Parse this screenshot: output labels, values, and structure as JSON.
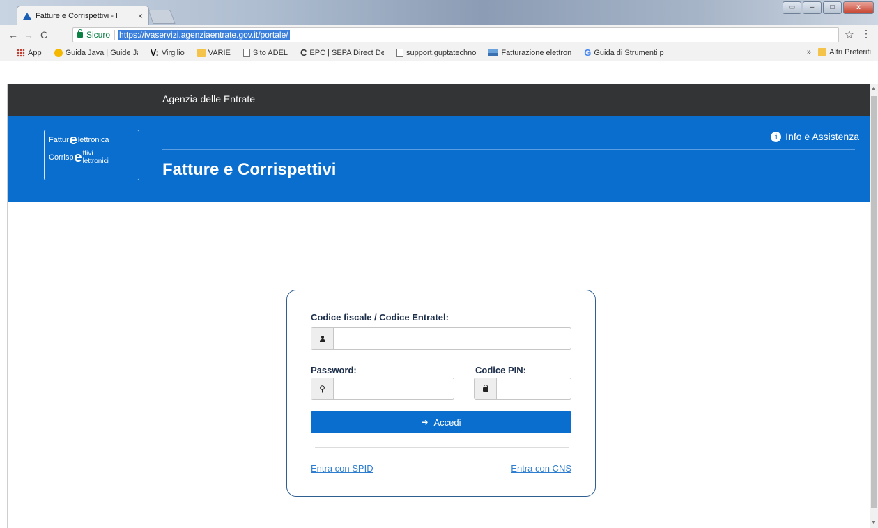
{
  "browser": {
    "tab_title": "Fatture e Corrispettivi - I",
    "tab_close": "×",
    "secure_label": "Sicuro",
    "url": "https://ivaservizi.agenziaentrate.gov.it/portale/",
    "bookmarks": [
      {
        "label": "App",
        "icon": "apps-icon"
      },
      {
        "label": "Guida Java | Guide Ja",
        "icon": "java-icon"
      },
      {
        "label": "Virgilio",
        "icon": "v-icon"
      },
      {
        "label": "VARIE",
        "icon": "folder-icon"
      },
      {
        "label": "Sito ADEL",
        "icon": "page-icon"
      },
      {
        "label": "EPC | SEPA Direct De",
        "icon": "c-icon"
      },
      {
        "label": "support.guptatechno",
        "icon": "page-icon"
      },
      {
        "label": "Fatturazione elettron",
        "icon": "flag-icon"
      },
      {
        "label": "Guida di Strumenti p",
        "icon": "g-icon"
      }
    ],
    "bookmarks_more": "»",
    "bookmarks_other": "Altri Preferiti"
  },
  "page": {
    "topbar_title": "Agenzia delle Entrate",
    "logo": {
      "line1_a": "Fattur",
      "line1_b": "lettronica",
      "line2_a": "Corrisp",
      "line2_b": "ttivi",
      "line2_c": "lettronici",
      "e_glyph": "e"
    },
    "title": "Fatture e Corrispettivi",
    "info_label": "Info e Assistenza",
    "accent_color": "#0a6ecf"
  },
  "login": {
    "cf_label": "Codice fiscale / Codice Entratel:",
    "cf_value": "",
    "password_label": "Password:",
    "password_value": "",
    "pin_label": "Codice PIN:",
    "pin_value": "",
    "submit_label": "Accedi",
    "spid_link": "Entra con SPID",
    "cns_link": "Entra con CNS"
  }
}
